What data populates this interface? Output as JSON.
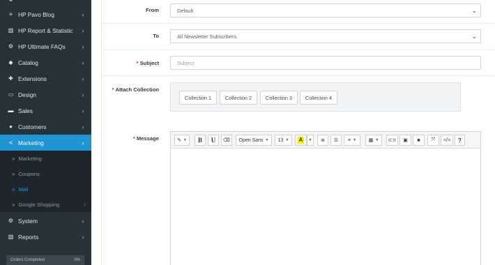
{
  "sidebar": {
    "items": [
      {
        "icon": "blog-icon",
        "glyph": "≡",
        "label": "HP Pavo Blog"
      },
      {
        "icon": "bar-chart-icon",
        "glyph": "▥",
        "label": "HP Report & Statistic"
      },
      {
        "icon": "cogs-icon",
        "glyph": "⚙",
        "label": "HP Ultimate FAQs"
      },
      {
        "icon": "tag-icon",
        "glyph": "◆",
        "label": "Catalog"
      },
      {
        "icon": "puzzle-icon",
        "glyph": "✚",
        "label": "Extensions"
      },
      {
        "icon": "desktop-icon",
        "glyph": "▭",
        "label": "Design"
      },
      {
        "icon": "cart-icon",
        "glyph": "▬",
        "label": "Sales"
      },
      {
        "icon": "user-icon",
        "glyph": "●",
        "label": "Customers"
      },
      {
        "icon": "share-icon",
        "glyph": "≺",
        "label": "Marketing"
      }
    ],
    "sub_items": [
      {
        "label": "Marketing"
      },
      {
        "label": "Coupons"
      },
      {
        "label": "Mail"
      },
      {
        "label": "Google Shopping"
      }
    ],
    "bottom_items": [
      {
        "icon": "cog-icon",
        "glyph": "⚙",
        "label": "System"
      },
      {
        "icon": "reports-icon",
        "glyph": "▥",
        "label": "Reports"
      }
    ],
    "orders_completed": {
      "label": "Orders Completed",
      "value": "0%"
    }
  },
  "form": {
    "from": {
      "label": "From",
      "value": "Default"
    },
    "to": {
      "label": "To",
      "value": "All Newsletter Subscribers"
    },
    "subject": {
      "label": "Subject",
      "required": "*",
      "placeholder": "Subject"
    },
    "attach": {
      "label": "Attach Collection",
      "required": "*",
      "buttons": [
        "Collection 1",
        "Collection 2",
        "Collection 3",
        "Collection 4"
      ]
    },
    "message": {
      "label": "Message",
      "required": "*"
    }
  },
  "editor_toolbar": {
    "style": "✎",
    "bold": "B",
    "underline": "U",
    "clear": "⌫",
    "font_family": "Open Sans",
    "font_size": "13",
    "color_letter": "A",
    "ul": "≣",
    "ol": "☰",
    "align": "≡",
    "table": "▦",
    "link": "⊂⊃",
    "picture": "▣",
    "video": "■",
    "fullscreen": "⤧",
    "code": "</>",
    "help": "?"
  },
  "colors": {
    "sidebar_bg": "#263238",
    "active": "#1f95d4",
    "required": "#e2231a"
  }
}
